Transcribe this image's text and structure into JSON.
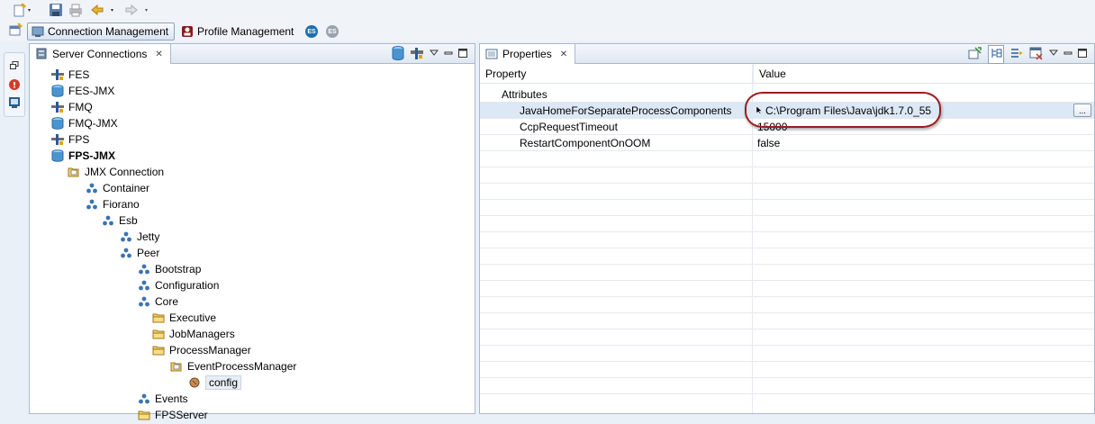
{
  "perspectives": [
    {
      "label": "Connection Management",
      "active": true
    },
    {
      "label": "Profile Management",
      "active": false
    }
  ],
  "server_view": {
    "tab_label": "Server Connections",
    "tree": [
      {
        "label": "FES",
        "icon": "server-antenna-icon",
        "bold": false
      },
      {
        "label": "FES-JMX",
        "icon": "database-icon",
        "bold": false
      },
      {
        "label": "FMQ",
        "icon": "server-antenna-icon",
        "bold": false
      },
      {
        "label": "FMQ-JMX",
        "icon": "database-icon",
        "bold": false
      },
      {
        "label": "FPS",
        "icon": "server-antenna-icon",
        "bold": false
      },
      {
        "label": "FPS-JMX",
        "icon": "database-icon",
        "bold": true
      },
      {
        "label": "JMX Connection",
        "icon": "open-folder-icon",
        "bold": false
      },
      {
        "label": "Container",
        "icon": "mbean-domain-icon",
        "bold": false
      },
      {
        "label": "Fiorano",
        "icon": "mbean-domain-icon",
        "bold": false
      },
      {
        "label": "Esb",
        "icon": "mbean-domain-icon",
        "bold": false
      },
      {
        "label": "Jetty",
        "icon": "mbean-domain-icon",
        "bold": false
      },
      {
        "label": "Peer",
        "icon": "mbean-domain-icon",
        "bold": false
      },
      {
        "label": "Bootstrap",
        "icon": "mbean-domain-icon",
        "bold": false
      },
      {
        "label": "Configuration",
        "icon": "mbean-domain-icon",
        "bold": false
      },
      {
        "label": "Core",
        "icon": "mbean-domain-icon",
        "bold": false
      },
      {
        "label": "Executive",
        "icon": "folder-icon",
        "bold": false
      },
      {
        "label": "JobManagers",
        "icon": "folder-icon",
        "bold": false
      },
      {
        "label": "ProcessManager",
        "icon": "folder-icon",
        "bold": false
      },
      {
        "label": "EventProcessManager",
        "icon": "open-folder-icon",
        "bold": false
      },
      {
        "label": "config",
        "icon": "mbean-bean-icon",
        "bold": false,
        "selected": true
      },
      {
        "label": "Events",
        "icon": "mbean-domain-icon",
        "bold": false
      },
      {
        "label": "FPSServer",
        "icon": "folder-icon",
        "bold": false
      }
    ]
  },
  "properties_view": {
    "tab_label": "Properties",
    "columns": {
      "property": "Property",
      "value": "Value"
    },
    "category": "Attributes",
    "rows": [
      {
        "property": "JavaHomeForSeparateProcessComponents",
        "value": "C:\\Program Files\\Java\\jdk1.7.0_55",
        "selected": true,
        "button": "..."
      },
      {
        "property": "CcpRequestTimeout",
        "value": "15000",
        "selected": false
      },
      {
        "property": "RestartComponentOnOOM",
        "value": "false",
        "selected": false
      }
    ]
  },
  "colors": {
    "highlight_ring": "#9c1c1c",
    "selection": "#dce8f6",
    "view_border": "#a9b9cc"
  }
}
